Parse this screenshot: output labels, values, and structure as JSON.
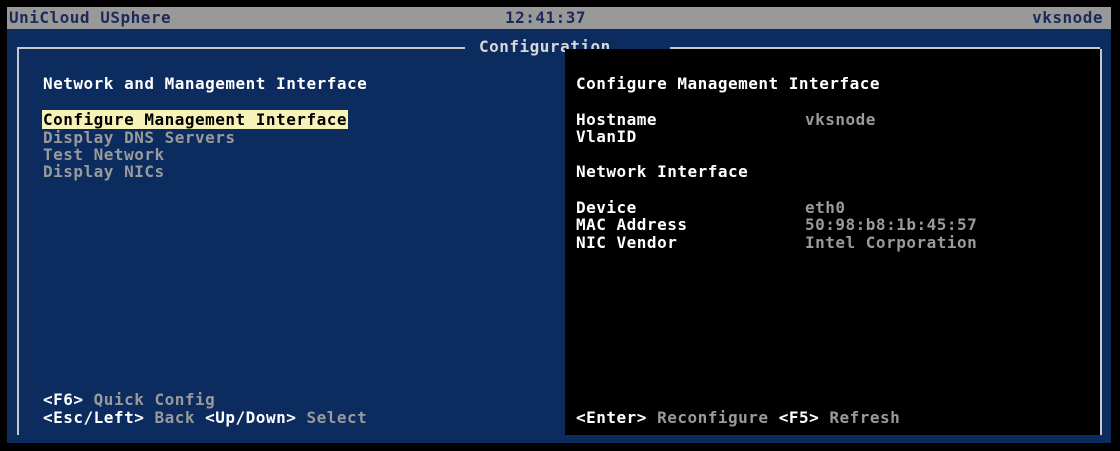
{
  "titlebar": {
    "product": "UniCloud USphere",
    "time": "12:41:37",
    "hostname": "vksnode"
  },
  "panel": {
    "title": "Configuration"
  },
  "left": {
    "section_title": "Network and Management Interface",
    "menu": [
      {
        "label": "Configure Management Interface",
        "selected": true
      },
      {
        "label": "Display DNS Servers",
        "selected": false
      },
      {
        "label": "Test Network",
        "selected": false
      },
      {
        "label": "Display NICs",
        "selected": false
      }
    ],
    "footer": {
      "quick_config_key": "<F6>",
      "quick_config_label": "Quick Config",
      "back_key": "<Esc/Left>",
      "back_label": "Back",
      "select_key": "<Up/Down>",
      "select_label": "Select"
    }
  },
  "right": {
    "section_title": "Configure Management Interface",
    "hostname_label": "Hostname",
    "hostname_value": "vksnode",
    "vlan_label": "VlanID",
    "vlan_value": "",
    "network_interface_heading": "Network Interface",
    "device_label": "Device",
    "device_value": "eth0",
    "mac_label": "MAC Address",
    "mac_value": "50:98:b8:1b:45:57",
    "vendor_label": "NIC Vendor",
    "vendor_value": "Intel Corporation",
    "footer": {
      "reconfigure_key": "<Enter>",
      "reconfigure_label": "Reconfigure",
      "refresh_key": "<F5>",
      "refresh_label": "Refresh"
    }
  },
  "colors": {
    "background_blue": "#0c2c60",
    "titlebar_gray": "#999999",
    "selection_yellow": "#f7f2b8",
    "pane_black": "#000000"
  }
}
